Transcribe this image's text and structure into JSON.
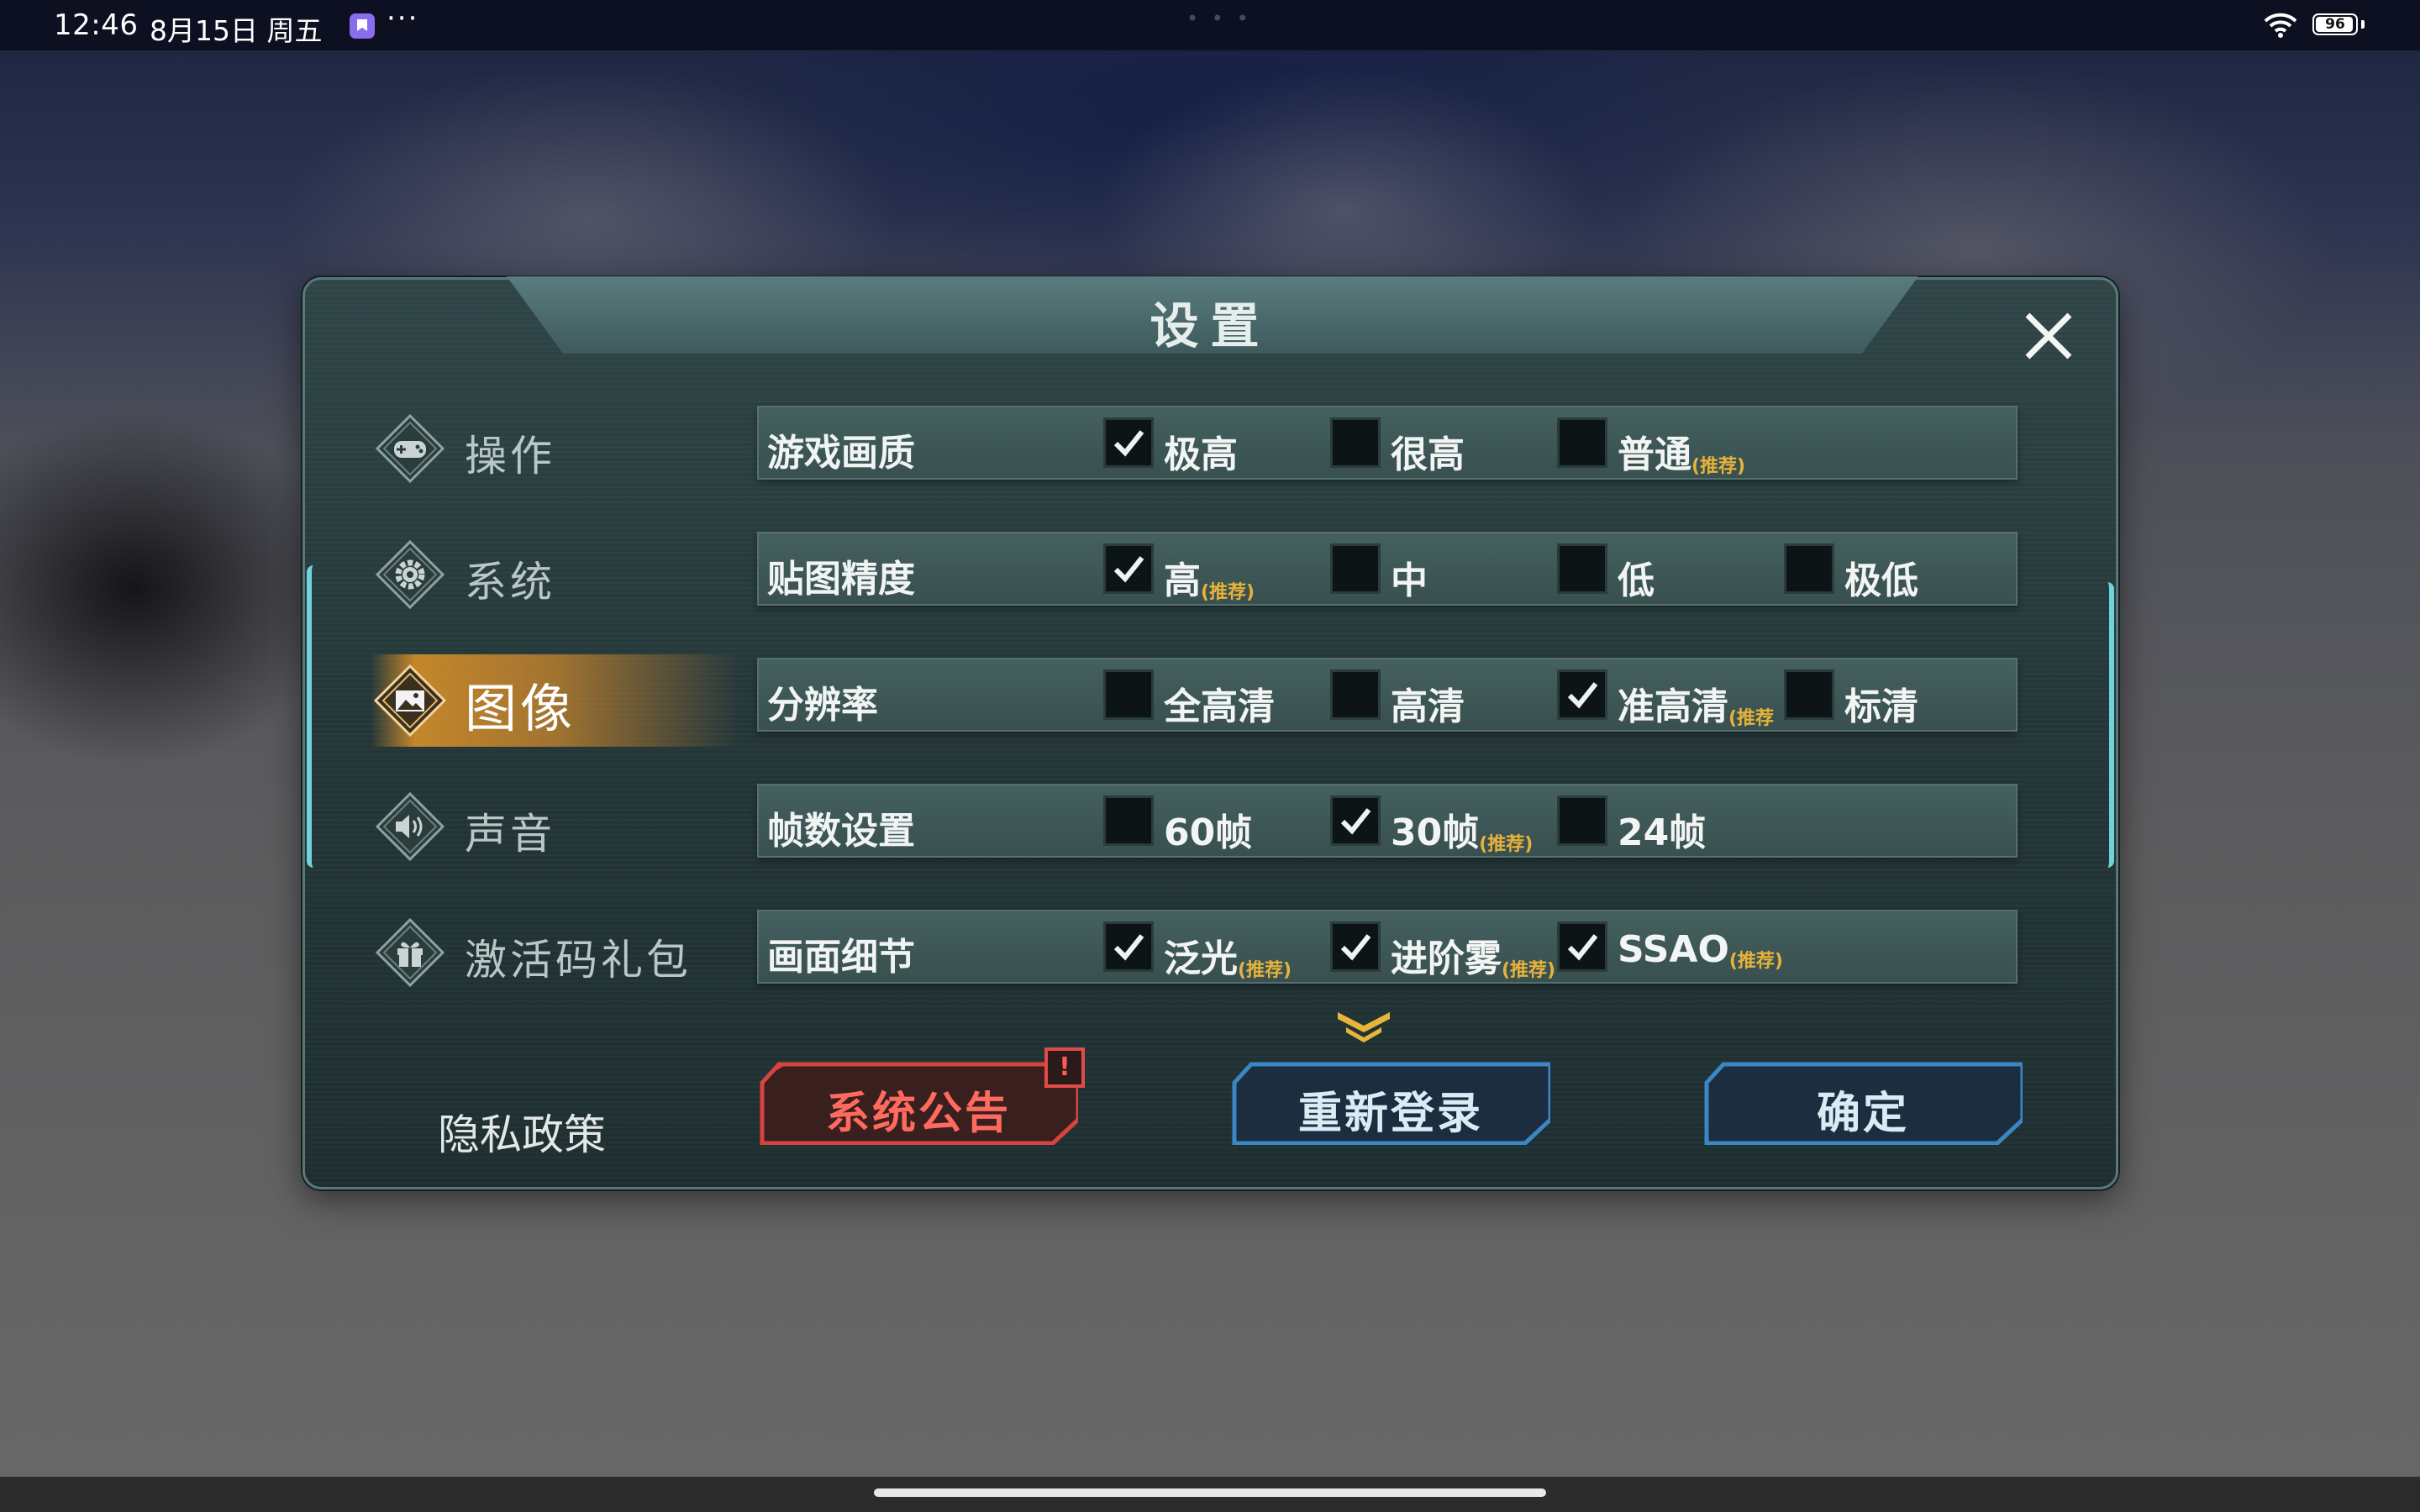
{
  "status_bar": {
    "time": "12:46",
    "date": "8月15日 周五",
    "more": "···",
    "battery": "96",
    "battery_level": 0.96
  },
  "panel": {
    "title": "设置",
    "close_icon": "close-icon"
  },
  "nav": {
    "items": [
      {
        "label": "操作",
        "icon": "gamepad-icon",
        "active": false
      },
      {
        "label": "系统",
        "icon": "gear-icon",
        "active": false
      },
      {
        "label": "图像",
        "icon": "image-icon",
        "active": true
      },
      {
        "label": "声音",
        "icon": "speaker-icon",
        "active": false
      },
      {
        "label": "激活码礼包",
        "icon": "gift-icon",
        "active": false
      }
    ],
    "privacy": "隐私政策"
  },
  "settings": {
    "rows": [
      {
        "label": "游戏画质",
        "options": [
          {
            "label": "极高",
            "rec": "",
            "checked": true
          },
          {
            "label": "很高",
            "rec": "",
            "checked": false
          },
          {
            "label": "普通",
            "rec": "(推荐)",
            "checked": false
          }
        ]
      },
      {
        "label": "贴图精度",
        "options": [
          {
            "label": "高",
            "rec": "(推荐)",
            "checked": true
          },
          {
            "label": "中",
            "rec": "",
            "checked": false
          },
          {
            "label": "低",
            "rec": "",
            "checked": false
          },
          {
            "label": "极低",
            "rec": "",
            "checked": false
          }
        ]
      },
      {
        "label": "分辨率",
        "options": [
          {
            "label": "全高清",
            "rec": "",
            "checked": false
          },
          {
            "label": "高清",
            "rec": "",
            "checked": false
          },
          {
            "label": "准高清",
            "rec": "(推荐",
            "checked": true
          },
          {
            "label": "标清",
            "rec": "",
            "checked": false
          }
        ]
      },
      {
        "label": "帧数设置",
        "options": [
          {
            "label": "60帧",
            "rec": "",
            "checked": false
          },
          {
            "label": "30帧",
            "rec": "(推荐)",
            "checked": true
          },
          {
            "label": "24帧",
            "rec": "",
            "checked": false
          }
        ]
      },
      {
        "label": "画面细节",
        "options": [
          {
            "label": "泛光",
            "rec": "(推荐)",
            "checked": true
          },
          {
            "label": "进阶雾",
            "rec": "(推荐)",
            "checked": true
          },
          {
            "label": "SSAO",
            "rec": "(推荐)",
            "checked": true
          }
        ]
      }
    ]
  },
  "buttons": {
    "notice": "系统公告",
    "notice_badge": "!",
    "relogin": "重新登录",
    "confirm": "确定"
  },
  "colors": {
    "accent_cyan": "#6fd3d9",
    "active_tab": "#e0942c",
    "recommend": "#e6b23a",
    "notice_red": "#e24b48"
  }
}
